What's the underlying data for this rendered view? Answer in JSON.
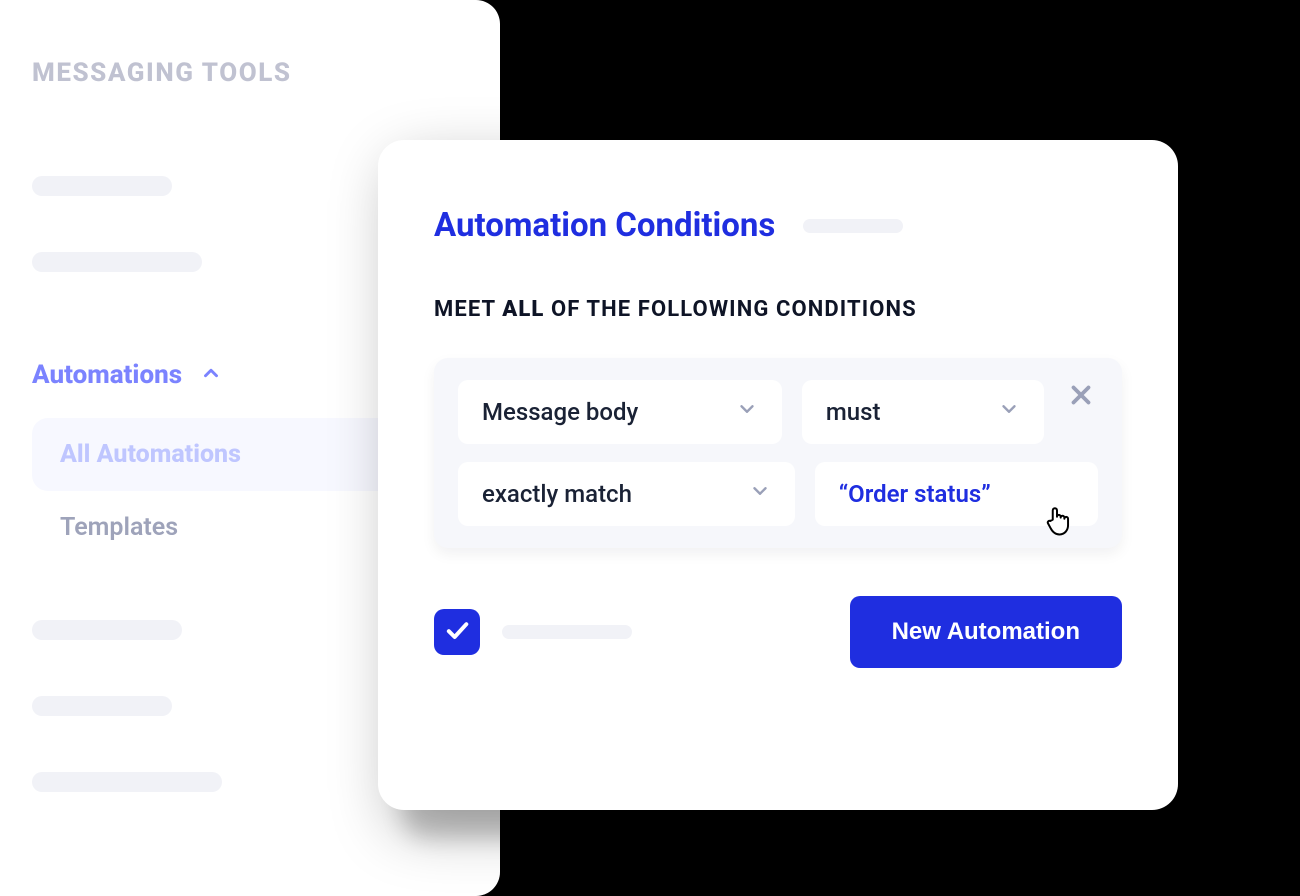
{
  "sidebar": {
    "title": "MESSAGING TOOLS",
    "group_label": "Automations",
    "items": [
      {
        "label": "All Automations"
      },
      {
        "label": "Templates"
      }
    ]
  },
  "card": {
    "title": "Automation Conditions",
    "subheader_prefix": "MEET ",
    "subheader_bold": "ALL",
    "subheader_suffix": " OF THE FOLLOWING CONDITIONS",
    "condition": {
      "field": "Message body",
      "qualifier": "must",
      "operator": "exactly match",
      "value": "“Order status”"
    },
    "cta_label": "New Automation"
  },
  "colors": {
    "primary": "#1f2ee0"
  }
}
